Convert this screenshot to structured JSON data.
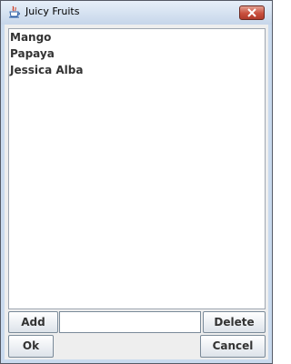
{
  "window": {
    "title": "Juicy Fruits",
    "app_icon": "java-coffee-cup-icon",
    "close_icon": "close-x-icon"
  },
  "list": {
    "items": [
      "Mango",
      "Papaya",
      "Jessica Alba"
    ]
  },
  "controls": {
    "add_label": "Add",
    "input_value": "",
    "delete_label": "Delete",
    "ok_label": "Ok",
    "cancel_label": "Cancel"
  }
}
